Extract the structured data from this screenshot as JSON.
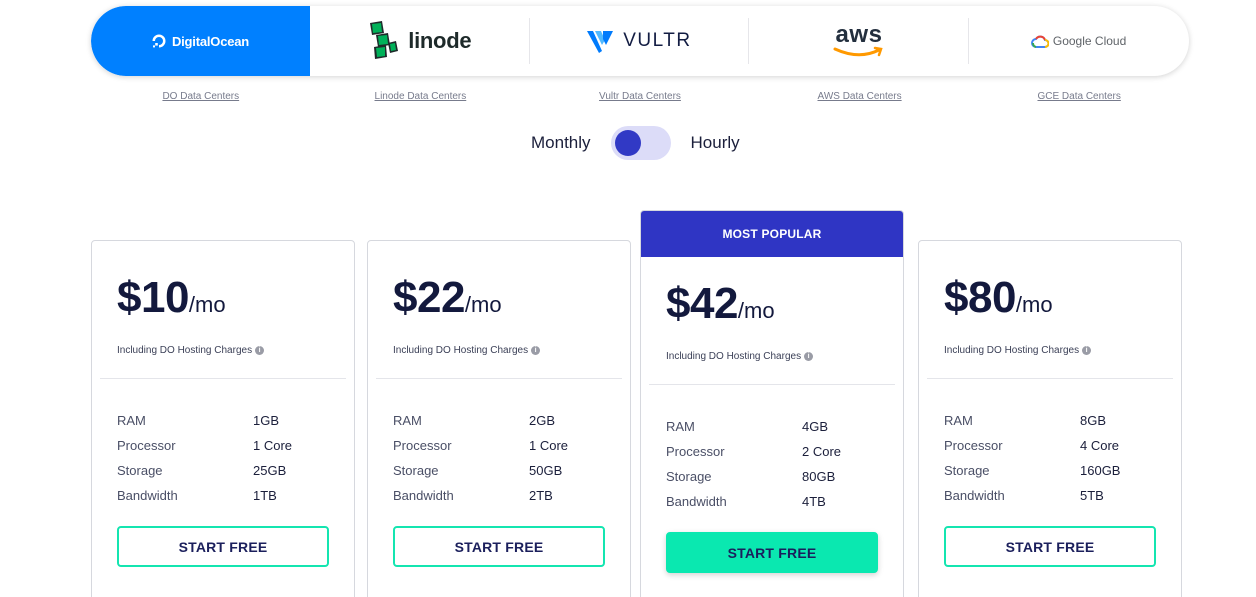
{
  "providers": [
    {
      "name": "DigitalOcean",
      "link": "DO Data Centers"
    },
    {
      "name": "linode",
      "link": "Linode Data Centers"
    },
    {
      "name": "VULTR",
      "link": "Vultr Data Centers"
    },
    {
      "name": "aws",
      "link": "AWS Data Centers"
    },
    {
      "name": "Google Cloud",
      "link": "GCE Data Centers"
    }
  ],
  "toggle": {
    "left": "Monthly",
    "right": "Hourly",
    "selected": "Monthly"
  },
  "colors": {
    "accent": "#0080ff",
    "primary": "#2f35c4",
    "cta": "#0ae8b0"
  },
  "plans": [
    {
      "price": "$10",
      "period": "/mo",
      "note": "Including DO Hosting Charges",
      "specs": [
        [
          "RAM",
          "1GB"
        ],
        [
          "Processor",
          "1 Core"
        ],
        [
          "Storage",
          "25GB"
        ],
        [
          "Bandwidth",
          "1TB"
        ]
      ],
      "cta": "START FREE"
    },
    {
      "price": "$22",
      "period": "/mo",
      "note": "Including DO Hosting Charges",
      "specs": [
        [
          "RAM",
          "2GB"
        ],
        [
          "Processor",
          "1 Core"
        ],
        [
          "Storage",
          "50GB"
        ],
        [
          "Bandwidth",
          "2TB"
        ]
      ],
      "cta": "START FREE"
    },
    {
      "badge": "MOST POPULAR",
      "price": "$42",
      "period": "/mo",
      "note": "Including DO Hosting Charges",
      "specs": [
        [
          "RAM",
          "4GB"
        ],
        [
          "Processor",
          "2 Core"
        ],
        [
          "Storage",
          "80GB"
        ],
        [
          "Bandwidth",
          "4TB"
        ]
      ],
      "cta": "START FREE"
    },
    {
      "price": "$80",
      "period": "/mo",
      "note": "Including DO Hosting Charges",
      "specs": [
        [
          "RAM",
          "8GB"
        ],
        [
          "Processor",
          "4 Core"
        ],
        [
          "Storage",
          "160GB"
        ],
        [
          "Bandwidth",
          "5TB"
        ]
      ],
      "cta": "START FREE"
    }
  ]
}
